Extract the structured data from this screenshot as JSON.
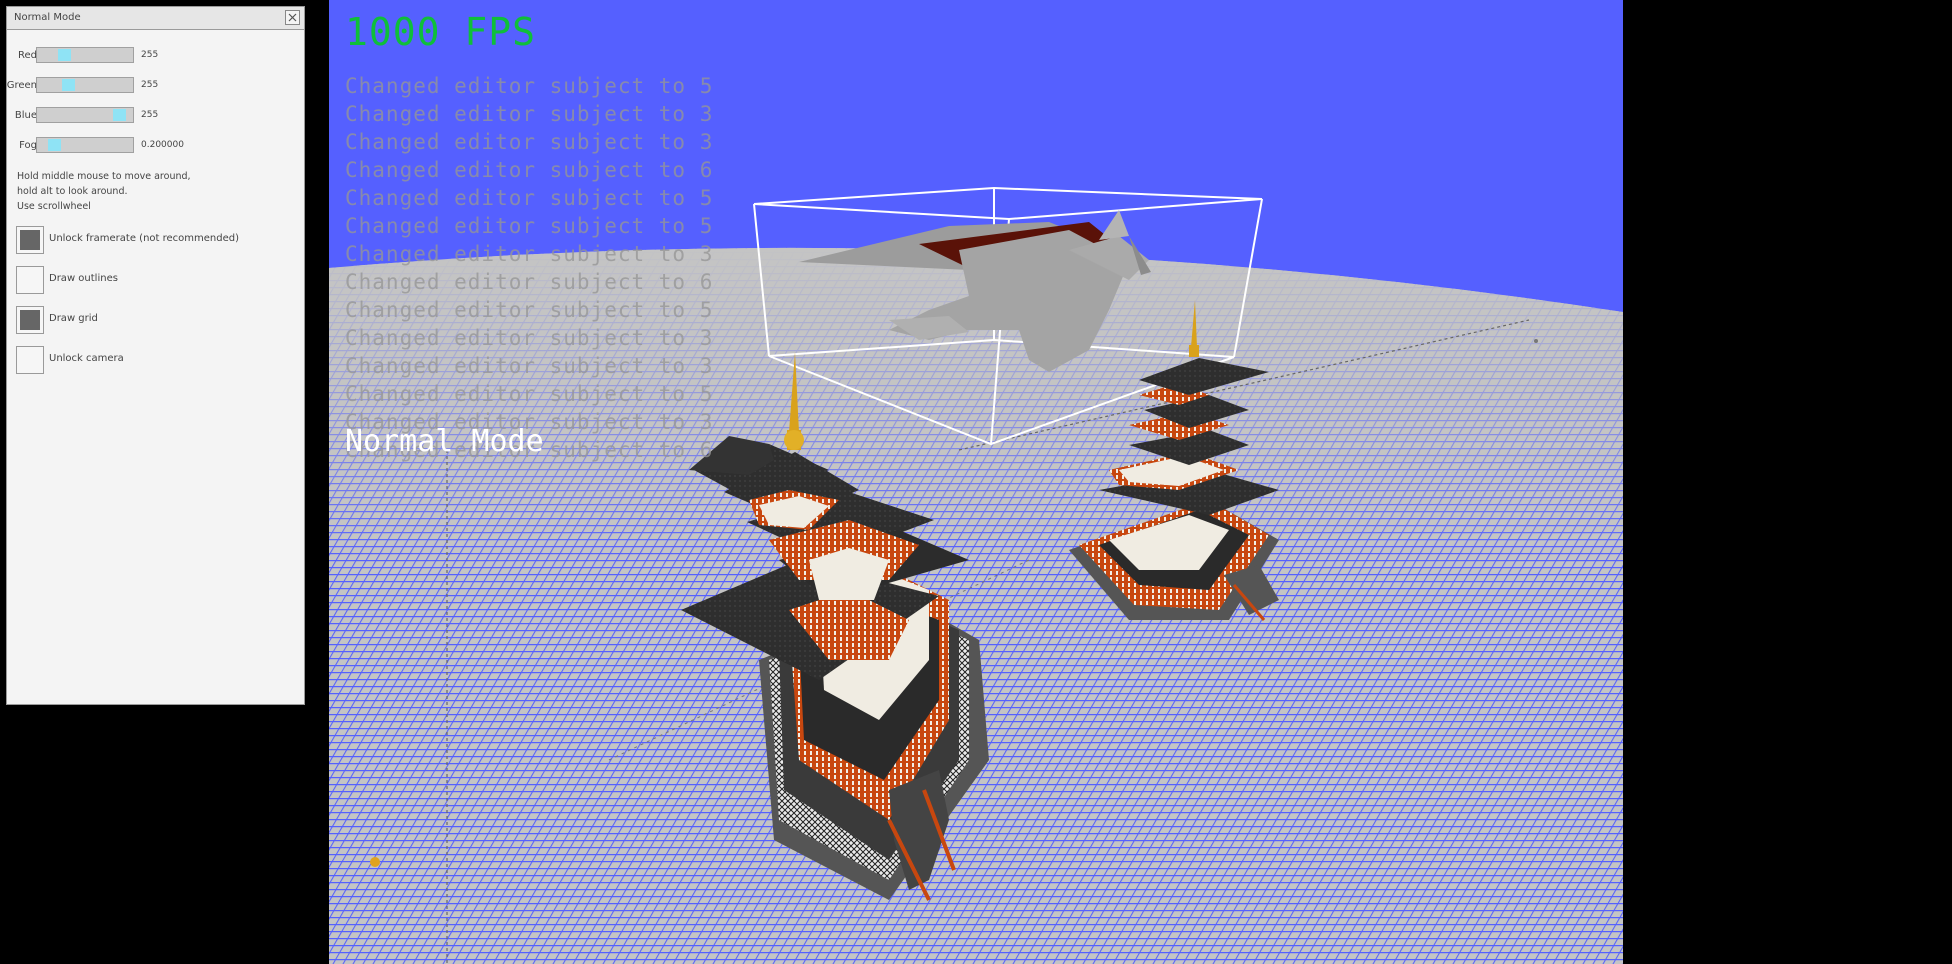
{
  "panel": {
    "title": "Normal Mode",
    "sliders": [
      {
        "label": "Red",
        "value": "255",
        "level": 0.25
      },
      {
        "label": "Green",
        "value": "255",
        "level": 0.3
      },
      {
        "label": "Blue",
        "value": "255",
        "level": 0.92
      },
      {
        "label": "Fog",
        "value": "0.200000",
        "level": 0.12
      }
    ],
    "help_lines": [
      "Hold middle mouse to move around,",
      "hold alt to look around.",
      "Use scrollwheel"
    ],
    "checkboxes": [
      {
        "label": "Unlock framerate (not recommended)",
        "checked": true
      },
      {
        "label": "Draw outlines",
        "checked": false
      },
      {
        "label": "Draw grid",
        "checked": true
      },
      {
        "label": "Unlock camera",
        "checked": false
      }
    ]
  },
  "viewport": {
    "fps": "1000 FPS",
    "log": [
      "Changed editor subject to 5",
      "Changed editor subject to 3",
      "Changed editor subject to 3",
      "Changed editor subject to 6",
      "Changed editor subject to 5",
      "Changed editor subject to 5",
      "Changed editor subject to 3",
      "Changed editor subject to 6",
      "Changed editor subject to 5",
      "Changed editor subject to 3",
      "Changed editor subject to 3",
      "Changed editor subject to 5",
      "Changed editor subject to 3",
      "Changed editor subject to 6"
    ],
    "mode_label": "Normal Mode"
  },
  "colors": {
    "sky": "#5560ff",
    "ground": "#c4c4c4",
    "fps_text": "#0fbf3a",
    "slider_thumb": "#8fe3f5",
    "roof": "#2c2c2c",
    "wood": "#c84a12",
    "gold": "#d9a21c"
  },
  "icons": [
    "close-icon"
  ]
}
